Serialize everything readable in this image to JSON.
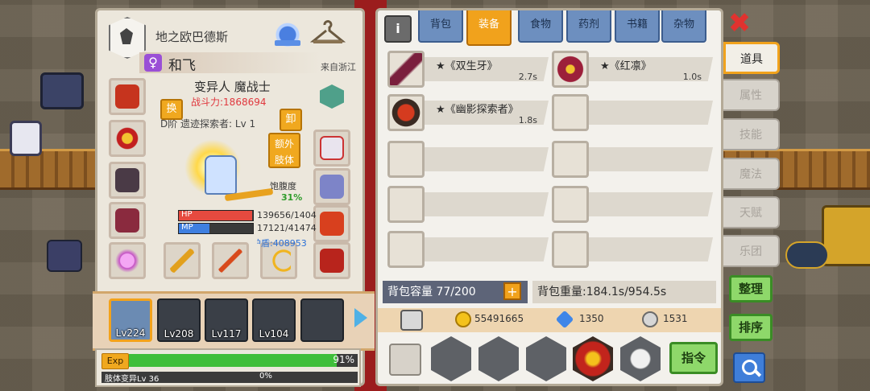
{
  "guild": {
    "name": "地之欧巴德斯"
  },
  "player": {
    "gender_symbol": "♀",
    "name": "和飞",
    "origin": "来自浙江",
    "class": "变异人 魔战士",
    "power": "战斗力:1868694",
    "title": "D阶 遗迹探索者: Lv 1"
  },
  "buttons": {
    "swap": "换",
    "unequip": "卸",
    "extra_limb_line1": "额外",
    "extra_limb_line2": "肢体"
  },
  "stats": {
    "satiety_label": "饱腹度",
    "satiety_value": "31%",
    "hp_label": "HP",
    "hp_value": "139656/1404",
    "hp_fill": 0.99,
    "mp_label": "MP",
    "mp_value": "17121/41474",
    "mp_fill": 0.41,
    "shield": "护盾:408953"
  },
  "pets": [
    {
      "level": "Lv224",
      "selected": true
    },
    {
      "level": "Lv208",
      "selected": false
    },
    {
      "level": "Lv117",
      "selected": false
    },
    {
      "level": "Lv104",
      "selected": false
    },
    {
      "level": "",
      "selected": false
    }
  ],
  "exp": {
    "tag": "Exp",
    "percent": "91%",
    "fill": 0.91,
    "limb_label": "肢体变异Lv 36",
    "limb_percent": "0%"
  },
  "tabs": [
    "背包",
    "装备",
    "食物",
    "药剂",
    "书籍",
    "杂物"
  ],
  "active_tab": "装备",
  "items": [
    {
      "name": "★《双生牙》",
      "time": "2.7s"
    },
    {
      "name": "★《红凛》",
      "time": "1.0s"
    },
    {
      "name": "★《幽影探索者》",
      "time": "1.8s"
    }
  ],
  "bag": {
    "capacity": "背包容量 77/200",
    "capacity_add": "+",
    "weight": "背包重量:184.1s/954.5s"
  },
  "currency": {
    "gold": "55491665",
    "diamond": "1350",
    "silver": "1531"
  },
  "order_button": "指令",
  "close_symbol": "✖",
  "side_tabs": [
    "道具",
    "属性",
    "技能",
    "魔法",
    "天赋",
    "乐团"
  ],
  "active_side_tab": "道具",
  "side_buttons": {
    "sort_tidy": "整理",
    "sort_order": "排序"
  },
  "colors": {
    "accent": "#f1a21c",
    "tab_blue": "#6d8fbf",
    "power_red": "#e0383e",
    "green": "#3fbe3a"
  }
}
